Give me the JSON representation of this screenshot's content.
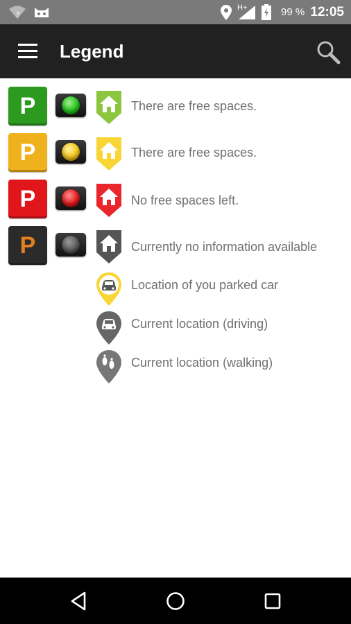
{
  "status_bar": {
    "battery_percent": "99 %",
    "time": "12:05",
    "network_type": "H+"
  },
  "app_bar": {
    "title": "Legend"
  },
  "legend": {
    "rows": [
      {
        "sign_letter": "P",
        "sign_color": "#2b9a1e",
        "sign_letter_color": "#ffffff",
        "light_color": "#22c21a",
        "pin_color": "#8cc63f",
        "pin_icon": "house-icon",
        "label": "There are free spaces."
      },
      {
        "sign_letter": "P",
        "sign_color": "#f0b21c",
        "sign_letter_color": "#ffffff",
        "light_color": "#f5c518",
        "pin_color": "#f9d536",
        "pin_icon": "house-icon",
        "label": "There are free spaces."
      },
      {
        "sign_letter": "P",
        "sign_color": "#e0161b",
        "sign_letter_color": "#ffffff",
        "light_color": "#e3191c",
        "pin_color": "#e8262c",
        "pin_icon": "house-icon",
        "label": "No free spaces left."
      },
      {
        "sign_letter": "P",
        "sign_color": "#2b2b2b",
        "sign_letter_color": "#e67e22",
        "light_color": "#5a5a5a",
        "pin_color": "#555555",
        "pin_icon": "house-icon",
        "label": "Currently no information available"
      }
    ],
    "pin_rows": [
      {
        "pin_color": "#f9d536",
        "pin_icon": "car-icon",
        "label": "Location of you parked car"
      },
      {
        "pin_color": "#666666",
        "pin_icon": "car-icon",
        "label": "Current location (driving)"
      },
      {
        "pin_color": "#777777",
        "pin_icon": "footprints-icon",
        "label": "Current location (walking)"
      }
    ]
  },
  "nav_bar": {
    "buttons": [
      "back-icon",
      "home-icon",
      "recents-icon"
    ]
  }
}
